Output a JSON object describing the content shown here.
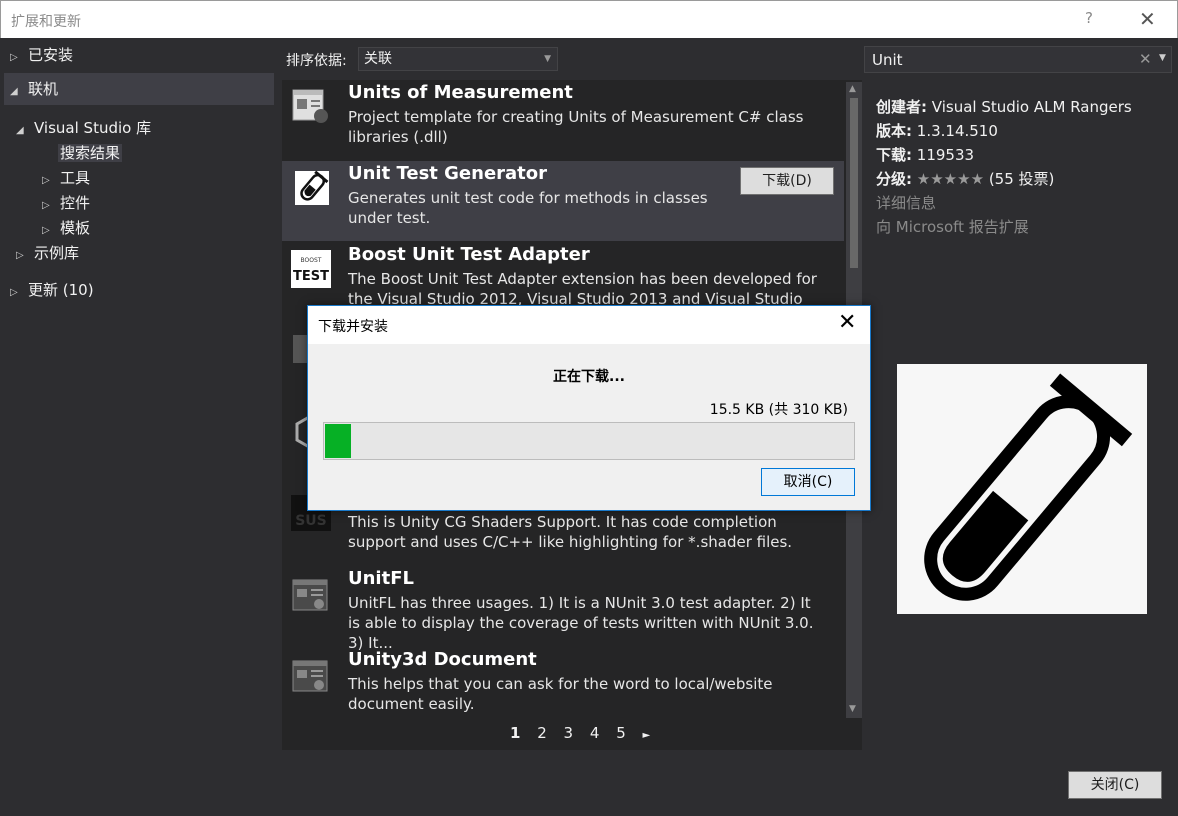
{
  "window": {
    "title": "扩展和更新",
    "help": "?",
    "close": "✕"
  },
  "tree": {
    "installed": "已安装",
    "online": "联机",
    "vs_gallery": "Visual Studio 库",
    "search_results": "搜索结果",
    "tools": "工具",
    "controls": "控件",
    "templates": "模板",
    "samples": "示例库",
    "updates": "更新 (10)"
  },
  "sort": {
    "label": "排序依据:",
    "value": "关联"
  },
  "search": {
    "value": "Unit"
  },
  "list": {
    "items": [
      {
        "name": "Units of Measurement",
        "desc": "Project template for creating Units of Measurement C# class libraries (.dll)"
      },
      {
        "name": "Unit Test Generator",
        "desc": "Generates unit test code for methods in classes under test.",
        "button": "下载(D)"
      },
      {
        "name": "Boost Unit Test Adapter",
        "desc": "The Boost Unit Test Adapter extension has been developed for the Visual Studio 2012, Visual Studio 2013 and Visual Studio 201..."
      },
      {
        "name": "",
        "desc": "This is Unity CG Shaders Support. It has code completion support and uses C/C++ like highlighting for *.shader files."
      },
      {
        "name": "UnitFL",
        "desc": "UnitFL has three usages. 1) It is a NUnit 3.0 test adapter. 2) It is able to display the coverage of tests written with NUnit 3.0. 3) It..."
      },
      {
        "name": "Unity3d Document",
        "desc": "This helps that you can ask for the word to local/website document easily."
      }
    ]
  },
  "pager": {
    "pages": [
      "1",
      "2",
      "3",
      "4",
      "5"
    ],
    "current": "1",
    "next": "►"
  },
  "details": {
    "creator_label": "创建者:",
    "creator": "Visual Studio ALM Rangers",
    "version_label": "版本:",
    "version": "1.3.14.510",
    "downloads_label": "下载:",
    "downloads": "119533",
    "rating_label": "分级:",
    "rating_stars": "★★★★★",
    "rating_votes": "(55 投票)",
    "more_info": "详细信息",
    "report": "向 Microsoft 报告扩展"
  },
  "footer": {
    "close": "关闭(C)"
  },
  "dialog": {
    "title": "下载并安装",
    "status": "正在下载...",
    "size": "15.5 KB (共 310 KB)",
    "progress": 0.05,
    "cancel": "取消(C)"
  },
  "colors": {
    "progress": "#06b025",
    "accent": "#1979ca",
    "background": "#2d2d30"
  },
  "icons": [
    "document-template-icon",
    "test-tube-icon",
    "boost-test-logo",
    "shader-icon",
    "unitfl-icon",
    "unity3d-doc-icon"
  ]
}
